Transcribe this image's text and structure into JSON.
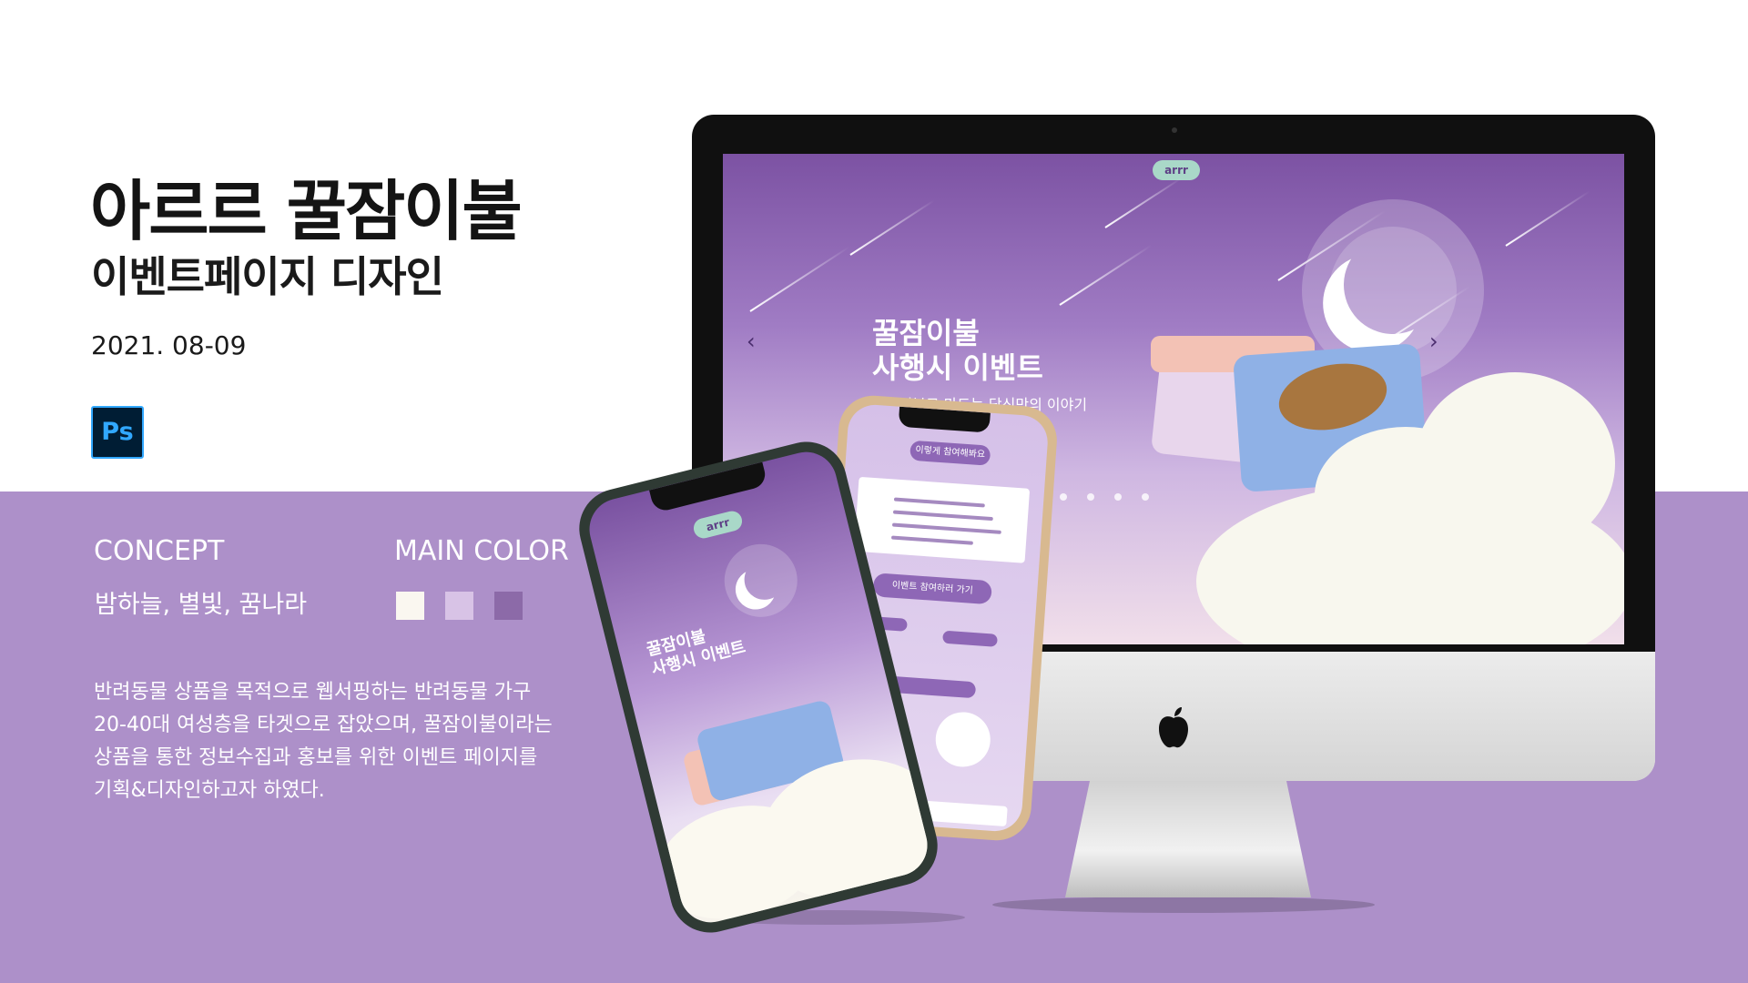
{
  "header": {
    "title": "아르르 꿀잠이불",
    "subtitle": "이벤트페이지 디자인",
    "date": "2021. 08-09",
    "tool_icon_text": "Ps"
  },
  "concept": {
    "label": "CONCEPT",
    "value": "밤하늘, 별빛, 꿈나라"
  },
  "main_color": {
    "label": "MAIN COLOR",
    "swatches": [
      "#faf7f0",
      "#d8c3e6",
      "#8c6aa8"
    ]
  },
  "description": {
    "lines": [
      "반려동물 상품을 목적으로 웹서핑하는 반려동물 가구",
      "20-40대 여성층을 타겟으로 잡았으며, 꿀잠이불이라는",
      "상품을 통한 정보수집과 홍보를 위한 이벤트 페이지를",
      "기획&디자인하고자 하였다."
    ]
  },
  "colors": {
    "band": "#ad90c9",
    "accent": "#8e67b6"
  },
  "mockup": {
    "logo": "arrr",
    "screen_title_line1": "꿀잠이불",
    "screen_title_line2": "사행시 이벤트",
    "screen_subtitle": "꿀잠이불로 만드는 당신만의 이야기",
    "phone_back_badge": "이렇게 참여해봐요",
    "phone_back_button": "이벤트 참여하러 가기",
    "phone_front_title_line1": "꿀잠이불",
    "phone_front_title_line2": "사행시 이벤트",
    "arrow_left": "‹",
    "arrow_right": "›",
    "apple_logo": ""
  }
}
